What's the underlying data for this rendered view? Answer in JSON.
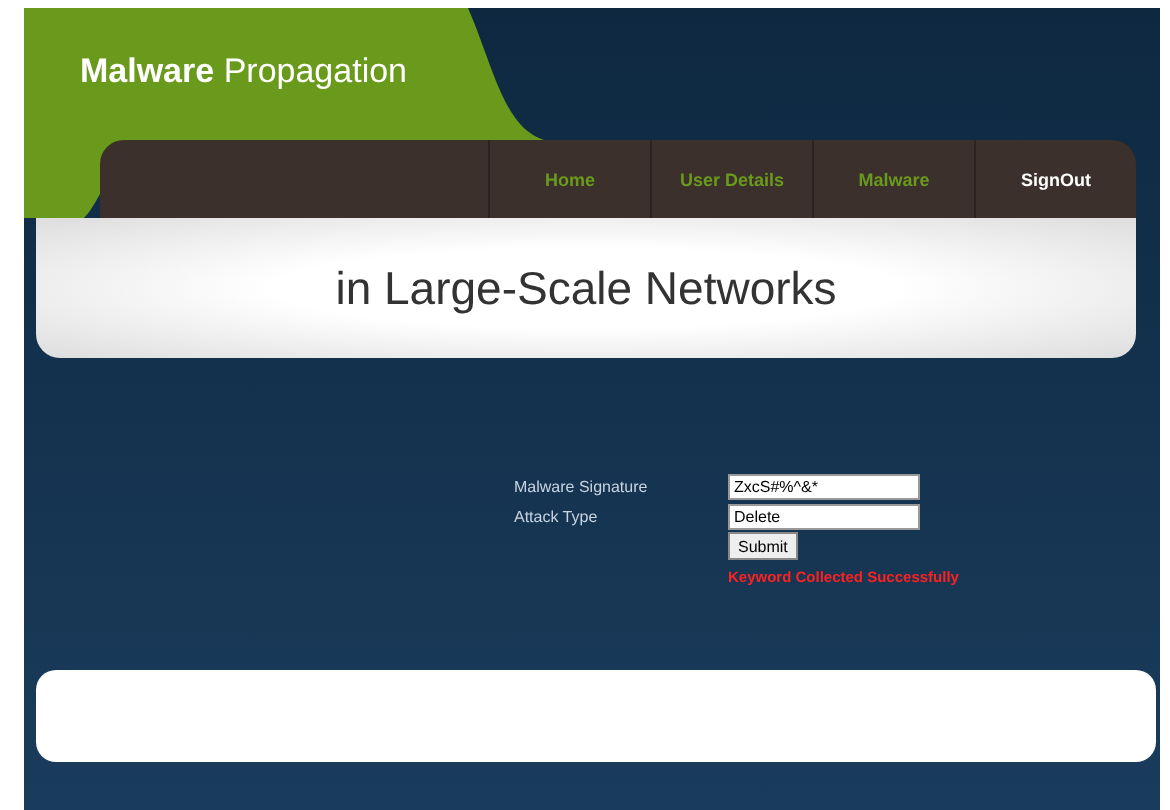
{
  "brand": {
    "bold": "Malware",
    "rest": "Propagation"
  },
  "nav": [
    {
      "label": "Home",
      "selected": false
    },
    {
      "label": "User Details",
      "selected": false
    },
    {
      "label": "Malware",
      "selected": false
    },
    {
      "label": "SignOut",
      "selected": true
    }
  ],
  "banner": {
    "title": "in Large-Scale Networks"
  },
  "form": {
    "fields": [
      {
        "label": "Malware Signature",
        "value": "ZxcS#%^&*"
      },
      {
        "label": "Attack Type",
        "value": "Delete"
      }
    ],
    "submit": "Submit",
    "message": "Keyword Collected Successfully"
  }
}
